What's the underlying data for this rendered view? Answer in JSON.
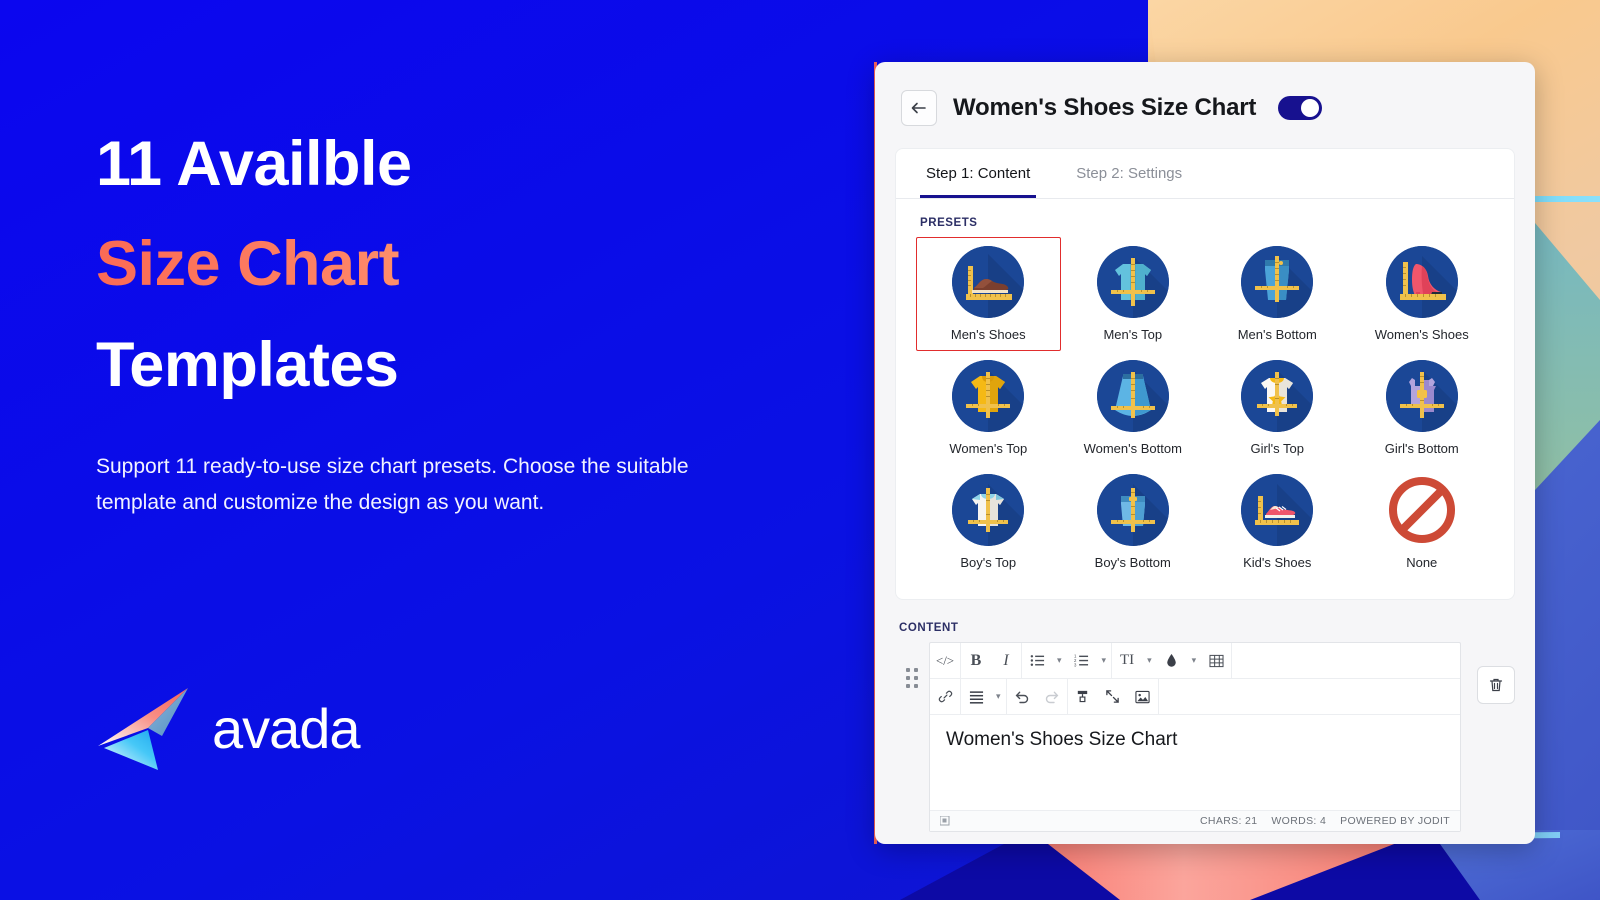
{
  "promo": {
    "headline_1": "11 Availble",
    "headline_2": "Size Chart",
    "headline_3": "Templates",
    "body": "Support 11 ready-to-use size chart presets. Choose the suitable template and customize the design as you want.",
    "brand": "avada",
    "accent_gradient_from": "#fb6a55",
    "accent_gradient_to": "#ffd9a1",
    "background_blue": "#0a0ae6"
  },
  "app": {
    "back_icon": "arrow-left-icon",
    "title": "Women's Shoes Size Chart",
    "enabled_toggle": "on",
    "toggle_color": "#17118f",
    "tabs": [
      {
        "label": "Step 1: Content",
        "active": true
      },
      {
        "label": "Step 2: Settings",
        "active": false
      }
    ],
    "presets_label": "PRESETS",
    "presets": [
      {
        "label": "Men's Shoes",
        "icon": "mens-shoe-icon",
        "selected": true
      },
      {
        "label": "Men's Top",
        "icon": "mens-shirt-icon",
        "selected": false
      },
      {
        "label": "Men's Bottom",
        "icon": "mens-jeans-icon",
        "selected": false
      },
      {
        "label": "Women's Shoes",
        "icon": "high-heel-icon",
        "selected": false
      },
      {
        "label": "Women's Top",
        "icon": "womens-tshirt-icon",
        "selected": false
      },
      {
        "label": "Women's Bottom",
        "icon": "womens-skirt-icon",
        "selected": false
      },
      {
        "label": "Girl's Top",
        "icon": "girls-tshirt-icon",
        "selected": false
      },
      {
        "label": "Girl's Bottom",
        "icon": "girls-overall-icon",
        "selected": false
      },
      {
        "label": "Boy's Top",
        "icon": "boys-tshirt-icon",
        "selected": false
      },
      {
        "label": "Boy's Bottom",
        "icon": "boys-shorts-icon",
        "selected": false
      },
      {
        "label": "Kid's Shoes",
        "icon": "kids-sneaker-icon",
        "selected": false
      },
      {
        "label": "None",
        "icon": "no-entry-icon",
        "selected": false
      }
    ],
    "selection_outline_color": "#e12d2d",
    "content_label": "CONTENT",
    "editor": {
      "toolbar_row_1": [
        {
          "name": "source-code-icon",
          "glyph": "</>"
        },
        {
          "name": "bold-icon",
          "glyph": "B"
        },
        {
          "name": "italic-icon",
          "glyph": "I"
        },
        {
          "name": "unordered-list-icon",
          "glyph": "list"
        },
        {
          "name": "ordered-list-icon",
          "glyph": "numlist"
        },
        {
          "name": "font-size-icon",
          "glyph": "TI"
        },
        {
          "name": "text-color-icon",
          "glyph": "droplet"
        },
        {
          "name": "table-icon",
          "glyph": "table"
        }
      ],
      "toolbar_row_2": [
        {
          "name": "link-icon",
          "glyph": "link"
        },
        {
          "name": "align-icon",
          "glyph": "align"
        },
        {
          "name": "undo-icon",
          "glyph": "undo"
        },
        {
          "name": "redo-icon",
          "glyph": "redo"
        },
        {
          "name": "eraser-icon",
          "glyph": "eraser"
        },
        {
          "name": "fullsize-icon",
          "glyph": "expand"
        },
        {
          "name": "image-icon",
          "glyph": "image"
        }
      ],
      "body_text": "Women's Shoes Size Chart",
      "status_chars": "CHARS: 21",
      "status_words": "WORDS: 4",
      "status_powered": "POWERED BY JODIT",
      "resize_icon": "resize-handle-icon"
    },
    "delete_icon": "trash-icon"
  }
}
